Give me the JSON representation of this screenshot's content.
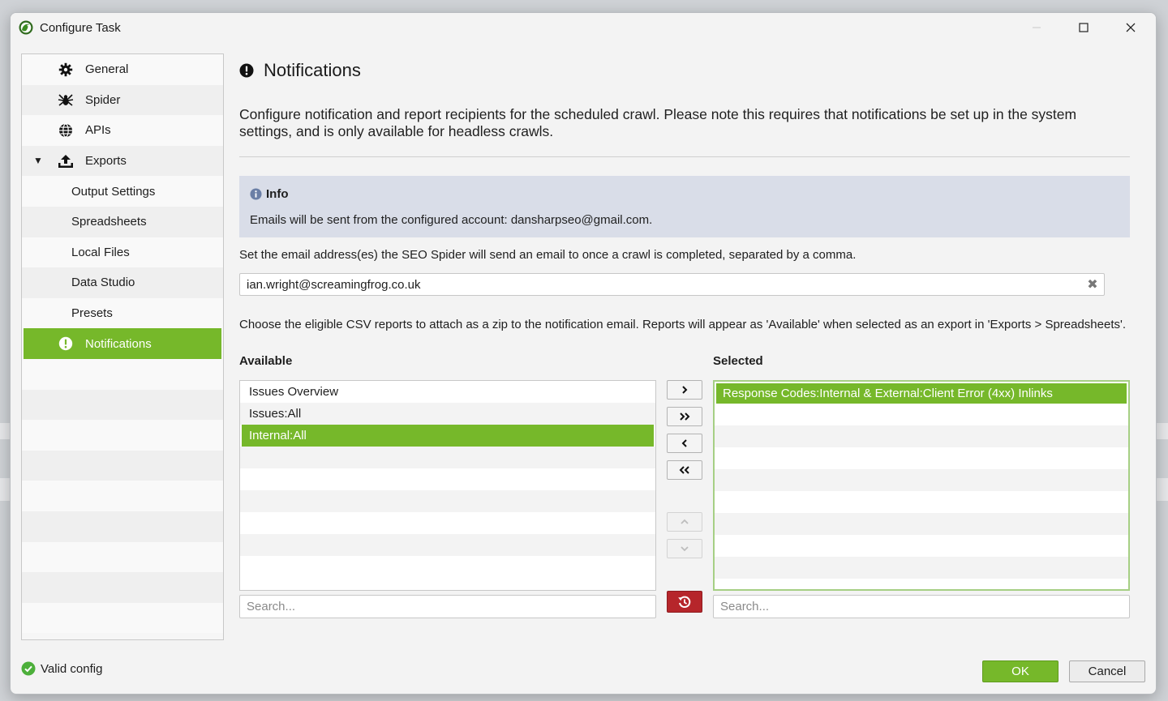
{
  "window": {
    "title": "Configure Task",
    "controls": {
      "minimize": "minimize-icon",
      "maximize": "maximize-icon",
      "close": "close-icon"
    }
  },
  "sidebar": {
    "items": [
      {
        "label": "General",
        "icon": "gear-icon"
      },
      {
        "label": "Spider",
        "icon": "spider-icon"
      },
      {
        "label": "APIs",
        "icon": "globe-icon"
      },
      {
        "label": "Exports",
        "icon": "upload-icon",
        "expanded": true
      },
      {
        "label": "Output Settings"
      },
      {
        "label": "Spreadsheets"
      },
      {
        "label": "Local Files"
      },
      {
        "label": "Data Studio"
      },
      {
        "label": "Presets"
      },
      {
        "label": "Notifications",
        "icon": "alert-icon",
        "active": true
      }
    ]
  },
  "main": {
    "title": "Notifications",
    "description": "Configure notification and report recipients for the scheduled crawl. Please note this requires that notifications be set up in the system settings, and is only available for headless crawls.",
    "info": {
      "title": "Info",
      "text": "Emails will be sent from the configured account: dansharpseo@gmail.com."
    },
    "email_label": "Set the email address(es) the SEO Spider will send an email to once a crawl is completed, separated by a comma.",
    "email_value": "ian.wright@screamingfrog.co.uk",
    "csv_label": "Choose the eligible CSV reports to attach as a zip to the notification email. Reports will appear as 'Available' when selected as an export in 'Exports > Spreadsheets'.",
    "available": {
      "heading": "Available",
      "items": [
        "Issues Overview",
        "Issues:All",
        "Internal:All"
      ],
      "selected_index": 2,
      "search_placeholder": "Search..."
    },
    "selected": {
      "heading": "Selected",
      "items": [
        "Response Codes:Internal & External:Client Error (4xx) Inlinks"
      ],
      "selected_index": 0,
      "search_placeholder": "Search..."
    }
  },
  "footer": {
    "status": "Valid config",
    "ok_label": "OK",
    "cancel_label": "Cancel"
  },
  "colors": {
    "accent_green": "#76b82a",
    "info_bg": "#d9dde8",
    "reset_red": "#b6262b"
  }
}
